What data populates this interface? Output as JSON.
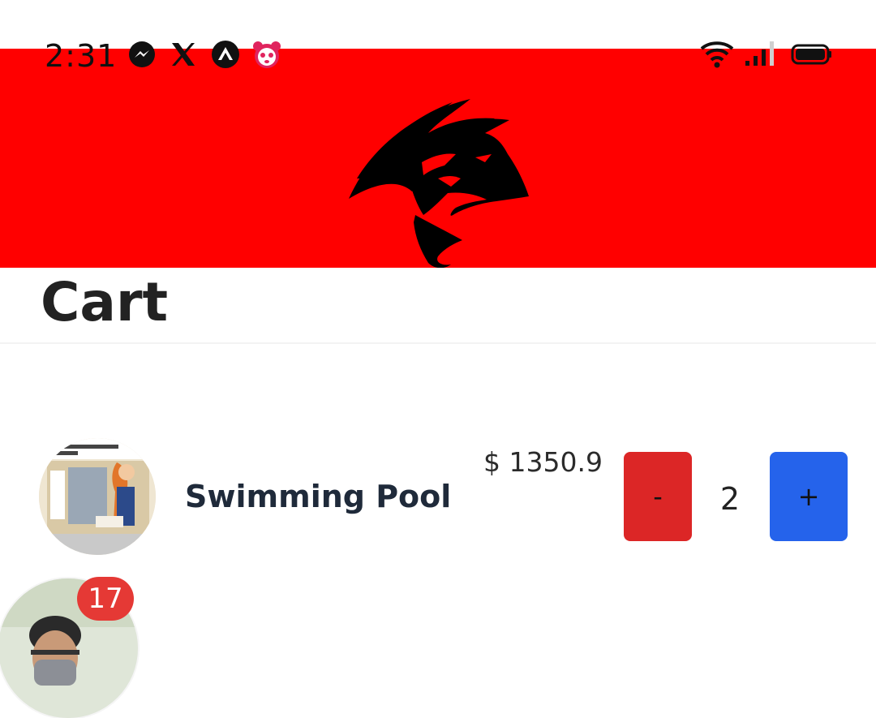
{
  "status_bar": {
    "time": "2:31",
    "notification_icons": [
      "messenger-icon",
      "x-icon",
      "arch-icon",
      "panda-icon"
    ],
    "system_icons": [
      "wifi-icon",
      "signal-icon",
      "battery-icon"
    ]
  },
  "header": {
    "banner_color": "#ff0000",
    "logo": "wolf-logo-icon"
  },
  "page": {
    "title": "Cart"
  },
  "cart": {
    "items": [
      {
        "name": "Swimming Pool",
        "price": "$ 1350.9",
        "quantity": "2",
        "thumbnail": "product-thumbnail"
      }
    ],
    "decrement_label": "-",
    "increment_label": "+",
    "decrement_color": "#dc2626",
    "increment_color": "#2563eb"
  },
  "chat_head": {
    "badge_count": "17"
  }
}
